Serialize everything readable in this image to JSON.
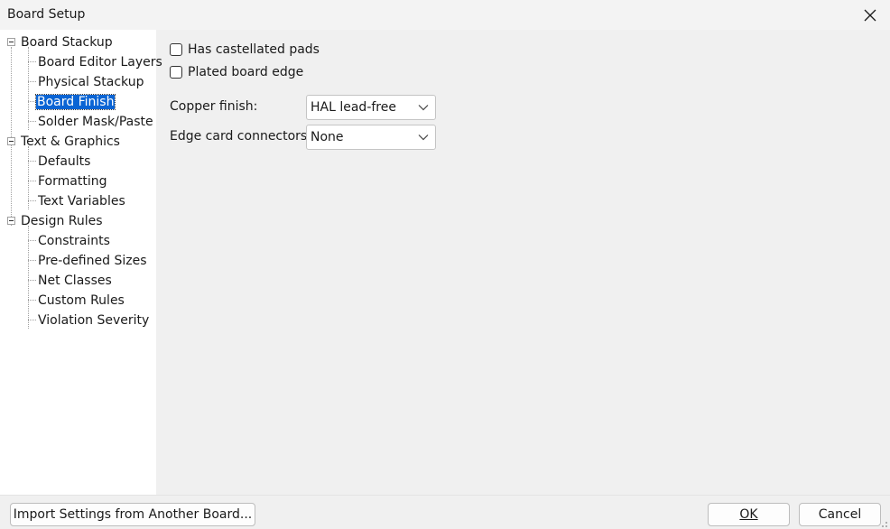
{
  "window": {
    "title": "Board Setup"
  },
  "sidebar": {
    "groups": [
      {
        "label": "Board Stackup",
        "children": [
          "Board Editor Layers",
          "Physical Stackup",
          "Board Finish",
          "Solder Mask/Paste"
        ]
      },
      {
        "label": "Text & Graphics",
        "children": [
          "Defaults",
          "Formatting",
          "Text Variables"
        ]
      },
      {
        "label": "Design Rules",
        "children": [
          "Constraints",
          "Pre-defined Sizes",
          "Net Classes",
          "Custom Rules",
          "Violation Severity"
        ]
      }
    ],
    "selected": "Board Finish"
  },
  "finish": {
    "castellated_label": "Has castellated pads",
    "castellated_checked": false,
    "plated_label": "Plated board edge",
    "plated_checked": false,
    "copper_label": "Copper finish:",
    "copper_value": "HAL lead-free",
    "edge_label": "Edge card connectors:",
    "edge_value": "None"
  },
  "footer": {
    "import_label": "Import Settings from Another Board...",
    "ok_label": "OK",
    "cancel_label": "Cancel"
  },
  "colors": {
    "selection": "#0a64d4",
    "sidebar_bg": "#ffffff",
    "dialog_bg": "#f0f0f0"
  }
}
